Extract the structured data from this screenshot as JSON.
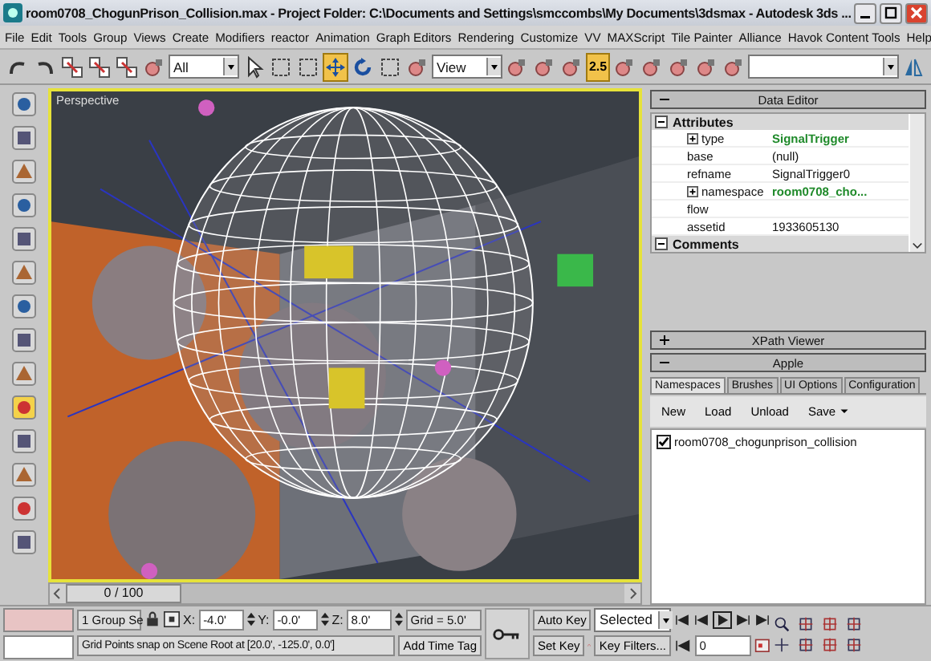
{
  "window": {
    "title": "room0708_ChogunPrison_Collision.max - Project Folder: C:\\Documents and Settings\\smccombs\\My Documents\\3dsmax - Autodesk 3ds ..."
  },
  "menu": [
    "File",
    "Edit",
    "Tools",
    "Group",
    "Views",
    "Create",
    "Modifiers",
    "reactor",
    "Animation",
    "Graph Editors",
    "Rendering",
    "Customize",
    "VV",
    "MAXScript",
    "Tile Painter",
    "Alliance",
    "Havok Content Tools",
    "Help"
  ],
  "toolbar": {
    "selection_filter": "All",
    "coordinate_system": "View",
    "tools": [
      {
        "kind": "undo",
        "selected": false
      },
      {
        "kind": "redo",
        "selected": false
      },
      {
        "kind": "link",
        "selected": false
      },
      {
        "kind": "unlink",
        "selected": false
      },
      {
        "kind": "bind",
        "selected": false
      },
      {
        "kind": "filter",
        "selected": false
      },
      {
        "kind": "select",
        "selected": false
      },
      {
        "kind": "region",
        "selected": false
      },
      {
        "kind": "window",
        "selected": false
      },
      {
        "kind": "move",
        "selected": true
      },
      {
        "kind": "rotate",
        "selected": false
      },
      {
        "kind": "scale",
        "selected": false
      },
      {
        "kind": "coord",
        "selected": false
      },
      {
        "kind": "pivot",
        "selected": false
      },
      {
        "kind": "manipulate",
        "selected": false
      },
      {
        "kind": "keyboard",
        "selected": false
      },
      {
        "kind": "snap",
        "label": "2.5",
        "selected": true
      },
      {
        "kind": "angle",
        "selected": false
      },
      {
        "kind": "percent",
        "selected": false
      },
      {
        "kind": "spinner",
        "selected": false
      },
      {
        "kind": "edit",
        "selected": false
      },
      {
        "kind": "named",
        "selected": false
      },
      {
        "kind": "mirror",
        "selected": false
      }
    ]
  },
  "viewport": {
    "label": "Perspective",
    "active": true
  },
  "time_slider": {
    "label": "0 / 100",
    "level": 0
  },
  "data_editor": {
    "title": "Data Editor",
    "expanded": true,
    "sections": [
      {
        "title": "Attributes",
        "expanded": true,
        "rows": [
          {
            "name": "type",
            "value": "SignalTrigger",
            "expandable": true,
            "highlighted": true
          },
          {
            "name": "base",
            "value": "(null)",
            "expandable": false,
            "highlighted": false
          },
          {
            "name": "refname",
            "value": "SignalTrigger0",
            "expandable": false,
            "highlighted": false
          },
          {
            "name": "namespace",
            "value": "room0708_cho...",
            "expandable": true,
            "highlighted": true
          },
          {
            "name": "flow",
            "expandable": false
          },
          {
            "name": "assetid",
            "value": "1933605130",
            "expandable": false,
            "highlighted": false
          }
        ]
      },
      {
        "title": "Comments",
        "expanded": true
      }
    ]
  },
  "rollouts": [
    {
      "title": "XPath Viewer",
      "expanded": false
    },
    {
      "title": "Apple",
      "expanded": true
    }
  ],
  "apple": {
    "tabs": [
      {
        "label": "Namespaces",
        "selected": true
      },
      {
        "label": "Brushes",
        "selected": false
      },
      {
        "label": "UI Options",
        "selected": false
      },
      {
        "label": "Configuration",
        "selected": false
      }
    ],
    "buttons": [
      {
        "label": "New",
        "dropdown": false
      },
      {
        "label": "Load",
        "dropdown": false
      },
      {
        "label": "Unload",
        "dropdown": false
      },
      {
        "label": "Save",
        "dropdown": true
      }
    ],
    "items": [
      {
        "label": "room0708_chogunprison_collision",
        "checked": true
      }
    ]
  },
  "status": {
    "selection": "1 Group Se",
    "x_label": "X:",
    "x": "-4.0'",
    "y_label": "Y:",
    "z_label": "Z:",
    "y": "-0.0'",
    "z": "8.0'",
    "grid": "Grid = 5.0'",
    "prompt": "Grid Points snap on Scene Root at [20.0', -125.0', 0.0']",
    "time_tag": "Add Time Tag",
    "auto_key": "Auto Key",
    "set_key": "Set Key",
    "key_mode": "Selected",
    "key_filters": "Key Filters...",
    "frame": "0"
  }
}
